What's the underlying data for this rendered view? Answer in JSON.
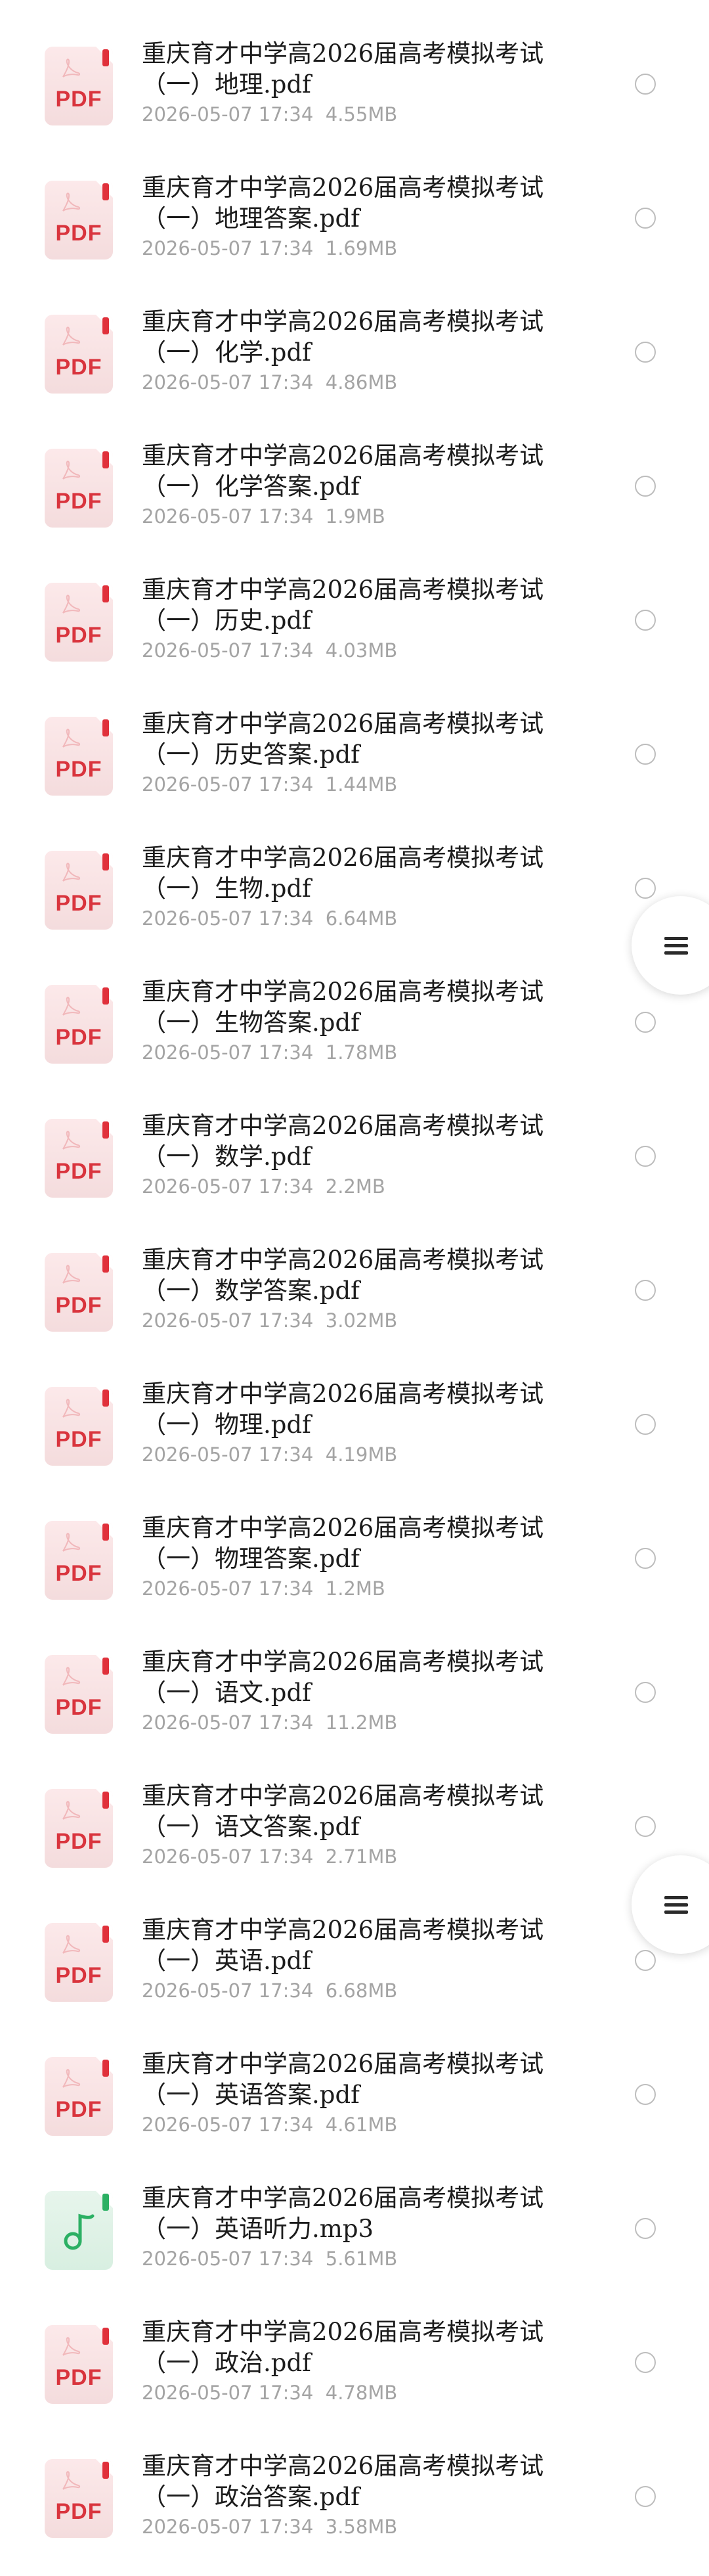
{
  "files": [
    {
      "name": "重庆育才中学高2026届高考模拟考试（一）地理.pdf",
      "date": "2026-05-07 17:34",
      "size": "4.55MB",
      "type": "pdf",
      "icon": "pdf-file-icon"
    },
    {
      "name": "重庆育才中学高2026届高考模拟考试（一）地理答案.pdf",
      "date": "2026-05-07 17:34",
      "size": "1.69MB",
      "type": "pdf",
      "icon": "pdf-file-icon"
    },
    {
      "name": "重庆育才中学高2026届高考模拟考试（一）化学.pdf",
      "date": "2026-05-07 17:34",
      "size": "4.86MB",
      "type": "pdf",
      "icon": "pdf-file-icon"
    },
    {
      "name": "重庆育才中学高2026届高考模拟考试（一）化学答案.pdf",
      "date": "2026-05-07 17:34",
      "size": "1.9MB",
      "type": "pdf",
      "icon": "pdf-file-icon"
    },
    {
      "name": "重庆育才中学高2026届高考模拟考试（一）历史.pdf",
      "date": "2026-05-07 17:34",
      "size": "4.03MB",
      "type": "pdf",
      "icon": "pdf-file-icon"
    },
    {
      "name": "重庆育才中学高2026届高考模拟考试（一）历史答案.pdf",
      "date": "2026-05-07 17:34",
      "size": "1.44MB",
      "type": "pdf",
      "icon": "pdf-file-icon"
    },
    {
      "name": "重庆育才中学高2026届高考模拟考试（一）生物.pdf",
      "date": "2026-05-07 17:34",
      "size": "6.64MB",
      "type": "pdf",
      "icon": "pdf-file-icon"
    },
    {
      "name": "重庆育才中学高2026届高考模拟考试（一）生物答案.pdf",
      "date": "2026-05-07 17:34",
      "size": "1.78MB",
      "type": "pdf",
      "icon": "pdf-file-icon"
    },
    {
      "name": "重庆育才中学高2026届高考模拟考试（一）数学.pdf",
      "date": "2026-05-07 17:34",
      "size": "2.2MB",
      "type": "pdf",
      "icon": "pdf-file-icon"
    },
    {
      "name": "重庆育才中学高2026届高考模拟考试（一）数学答案.pdf",
      "date": "2026-05-07 17:34",
      "size": "3.02MB",
      "type": "pdf",
      "icon": "pdf-file-icon"
    },
    {
      "name": "重庆育才中学高2026届高考模拟考试（一）物理.pdf",
      "date": "2026-05-07 17:34",
      "size": "4.19MB",
      "type": "pdf",
      "icon": "pdf-file-icon"
    },
    {
      "name": "重庆育才中学高2026届高考模拟考试（一）物理答案.pdf",
      "date": "2026-05-07 17:34",
      "size": "1.2MB",
      "type": "pdf",
      "icon": "pdf-file-icon"
    },
    {
      "name": "重庆育才中学高2026届高考模拟考试（一）语文.pdf",
      "date": "2026-05-07 17:34",
      "size": "11.2MB",
      "type": "pdf",
      "icon": "pdf-file-icon"
    },
    {
      "name": "重庆育才中学高2026届高考模拟考试（一）语文答案.pdf",
      "date": "2026-05-07 17:34",
      "size": "2.71MB",
      "type": "pdf",
      "icon": "pdf-file-icon"
    },
    {
      "name": "重庆育才中学高2026届高考模拟考试（一）英语.pdf",
      "date": "2026-05-07 17:34",
      "size": "6.68MB",
      "type": "pdf",
      "icon": "pdf-file-icon"
    },
    {
      "name": "重庆育才中学高2026届高考模拟考试（一）英语答案.pdf",
      "date": "2026-05-07 17:34",
      "size": "4.61MB",
      "type": "pdf",
      "icon": "pdf-file-icon"
    },
    {
      "name": "重庆育才中学高2026届高考模拟考试（一）英语听力.mp3",
      "date": "2026-05-07 17:34",
      "size": "5.61MB",
      "type": "audio",
      "icon": "audio-file-icon"
    },
    {
      "name": "重庆育才中学高2026届高考模拟考试（一）政治.pdf",
      "date": "2026-05-07 17:34",
      "size": "4.78MB",
      "type": "pdf",
      "icon": "pdf-file-icon"
    },
    {
      "name": "重庆育才中学高2026届高考模拟考试（一）政治答案.pdf",
      "date": "2026-05-07 17:34",
      "size": "3.58MB",
      "type": "pdf",
      "icon": "pdf-file-icon"
    }
  ],
  "pdf_icon_label": "PDF",
  "floating_menu": {
    "icon": "menu-icon",
    "count": 2
  },
  "colors": {
    "pdf_accent": "#d9343d",
    "audio_accent": "#2bb063",
    "meta_text": "#a4a4a4",
    "radio_border": "#bdbdbd"
  }
}
